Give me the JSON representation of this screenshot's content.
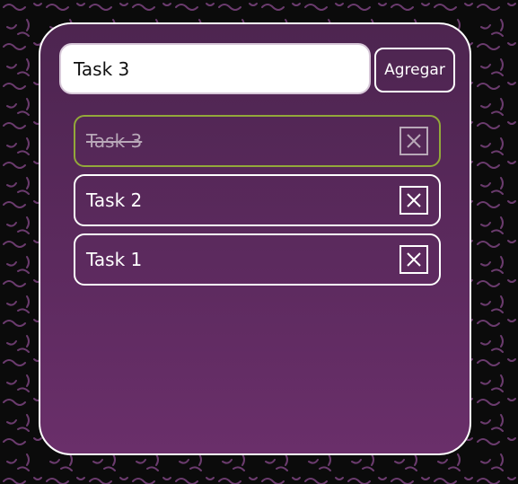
{
  "form": {
    "input_value": "Task 3",
    "add_label": "Agregar"
  },
  "tasks": [
    {
      "label": "Task 3",
      "done": true
    },
    {
      "label": "Task 2",
      "done": false
    },
    {
      "label": "Task 1",
      "done": false
    }
  ],
  "colors": {
    "card_top": "#4d2550",
    "card_bottom": "#6a2f6a",
    "done_border": "#93a83a",
    "pattern_stroke": "#6b3b6e"
  },
  "icons": {
    "delete": "close-icon"
  }
}
